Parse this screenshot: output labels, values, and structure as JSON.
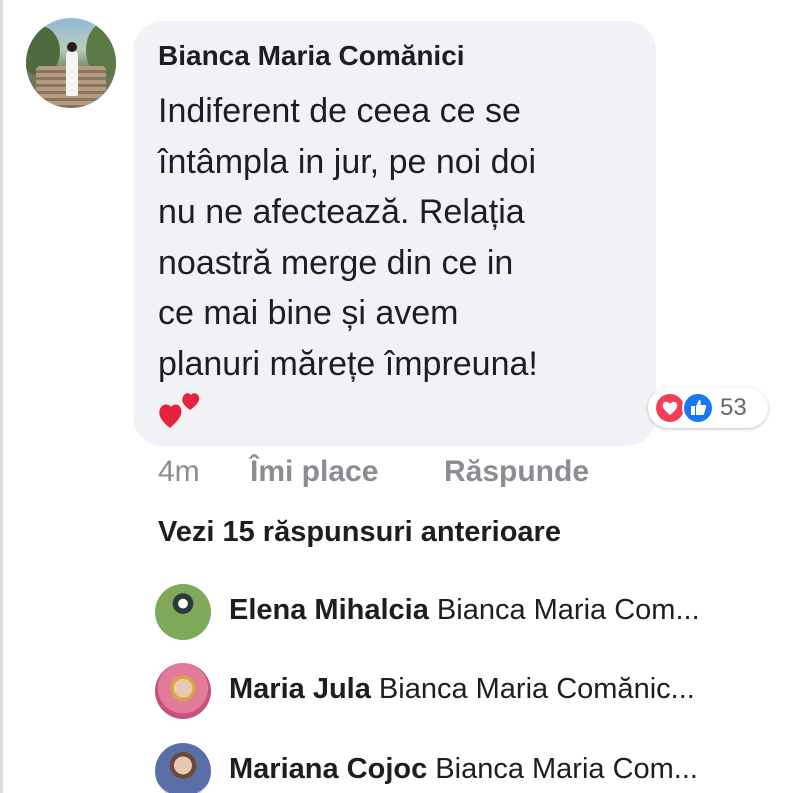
{
  "comment": {
    "author": "Bianca Maria Comănici",
    "text_lines": [
      "Indiferent de ceea ce se",
      "întâmpla in jur, pe noi doi",
      "nu ne afectează. Relația",
      "noastră merge din ce in",
      "ce mai bine și avem",
      "planuri mărețe împreuna!"
    ],
    "emoji": "two-hearts-icon",
    "reactions": {
      "icons": [
        "love-reaction-icon",
        "like-reaction-icon"
      ],
      "count": "53"
    },
    "time": "4m",
    "like_label": "Îmi place",
    "reply_label": "Răspunde"
  },
  "view_previous_replies": "Vezi 15 răspunsuri anterioare",
  "replies": [
    {
      "name": "Elena Mihalcia",
      "preview": "Bianca Maria Com..."
    },
    {
      "name": "Maria Jula",
      "preview": "Bianca Maria Comănic..."
    },
    {
      "name": "Mariana Cojoc",
      "preview": "Bianca Maria Com..."
    }
  ],
  "colors": {
    "bubble": "#f0f2f5",
    "text": "#1c1e21",
    "meta": "#8a8d91",
    "love": "#f33e58",
    "like": "#1877f2"
  }
}
